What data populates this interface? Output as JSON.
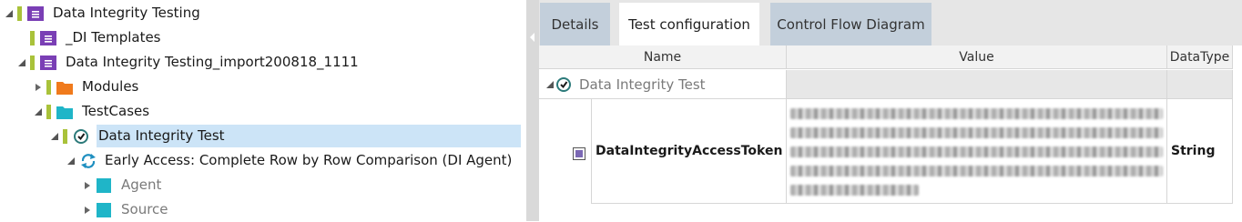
{
  "tree": {
    "items": [
      {
        "label": "Data Integrity Testing",
        "icon": "folder-purple-icon"
      },
      {
        "label": "_DI Templates",
        "icon": "folder-purple-icon"
      },
      {
        "label": "Data Integrity Testing_import200818_1111",
        "icon": "folder-purple-icon"
      },
      {
        "label": "Modules",
        "icon": "folder-orange-icon"
      },
      {
        "label": "TestCases",
        "icon": "folder-teal-icon"
      },
      {
        "label": "Data Integrity Test",
        "icon": "test-case-icon"
      },
      {
        "label": "Early Access: Complete Row by Row Comparison (DI Agent)",
        "icon": "refresh-icon"
      },
      {
        "label": "Agent",
        "icon": "square-teal-icon"
      },
      {
        "label": "Source",
        "icon": "square-teal-icon"
      }
    ]
  },
  "tabs": [
    {
      "label": "Details"
    },
    {
      "label": "Test configuration"
    },
    {
      "label": "Control Flow Diagram"
    }
  ],
  "grid": {
    "columns": {
      "name": "Name",
      "value": "Value",
      "datatype": "DataType"
    },
    "group": {
      "label": "Data Integrity Test",
      "icon": "test-case-icon"
    },
    "row": {
      "name": "DataIntegrityAccessToken",
      "value": "",
      "datatype": "String"
    }
  },
  "colors": {
    "accent_green": "#a9c23a",
    "folder_purple": "#7a3fb5",
    "folder_orange": "#f07a1c",
    "folder_teal": "#1fb5c8",
    "selection": "#cce4f7",
    "tab_inactive": "#c3cfdb"
  }
}
